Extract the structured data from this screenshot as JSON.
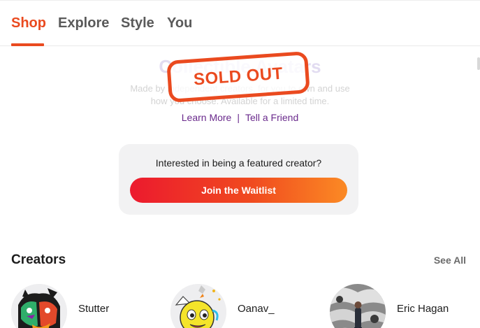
{
  "tabs": [
    {
      "label": "Shop",
      "active": true
    },
    {
      "label": "Explore",
      "active": false
    },
    {
      "label": "Style",
      "active": false
    },
    {
      "label": "You",
      "active": false
    }
  ],
  "hero": {
    "title": "Collectible Avatars",
    "description": "Made by independent creators, for you to own and use how you choose. Available for a limited time.",
    "badge": "SOLD OUT",
    "links": {
      "learn_more": "Learn More",
      "separator": "|",
      "tell_friend": "Tell a Friend"
    }
  },
  "featured": {
    "prompt": "Interested in being a featured creator?",
    "button_label": "Join the Waitlist"
  },
  "creators": {
    "title": "Creators",
    "see_all": "See All",
    "items": [
      {
        "name": "Stutter"
      },
      {
        "name": "Oanav_"
      },
      {
        "name": "Eric Hagan"
      }
    ]
  },
  "colors": {
    "accent": "#ea4a1f",
    "link": "#6a2a8c",
    "button_gradient": [
      "#ec1a2e",
      "#fb8a24"
    ]
  }
}
